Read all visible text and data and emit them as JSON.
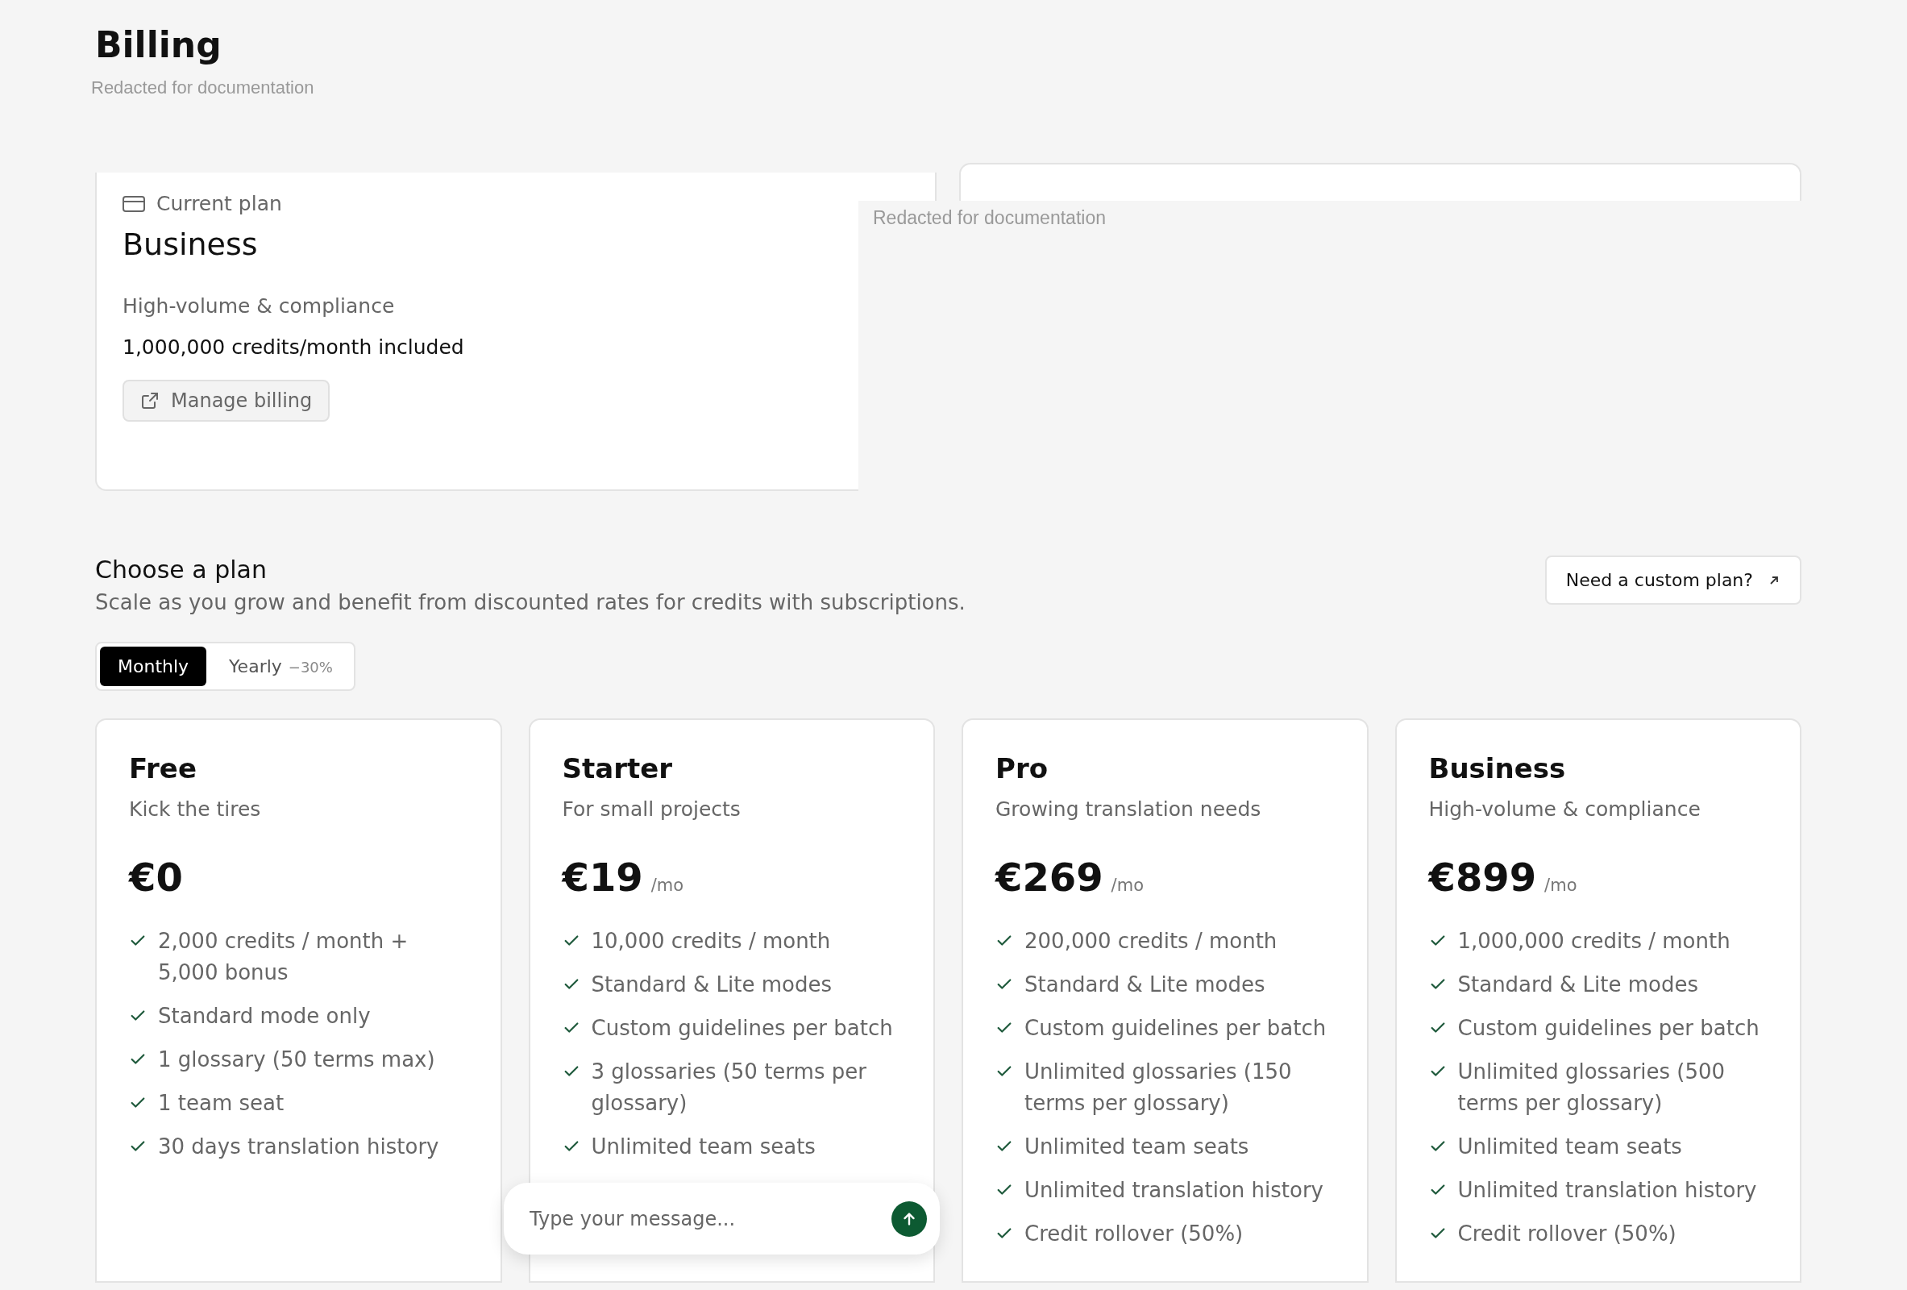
{
  "header": {
    "title": "Billing",
    "subtitle": "Redacted for documentation"
  },
  "current_plan": {
    "label": "Current plan",
    "name": "Business",
    "description": "High-volume & compliance",
    "credits": "1,000,000 credits/month included",
    "button": "Manage billing"
  },
  "redaction": {
    "text": "Redacted for documentation"
  },
  "plans_section": {
    "title": "Choose a plan",
    "subtitle": "Scale as you grow and benefit from discounted rates for credits with subscriptions.",
    "custom_plan_button": "Need a custom plan?",
    "billing_toggle": [
      {
        "label": "Monthly",
        "selected": true
      },
      {
        "label": "Yearly",
        "badge": "−30%",
        "selected": false
      }
    ],
    "plans": [
      {
        "name": "Free",
        "tagline": "Kick the tires",
        "price": "€0",
        "features": [
          "2,000 credits / month + 5,000 bonus",
          "Standard mode only",
          "1 glossary (50 terms max)",
          "1 team seat",
          "30 days translation history"
        ]
      },
      {
        "name": "Starter",
        "tagline": "For small projects",
        "price": "€19",
        "period": "/mo",
        "features": [
          "10,000 credits / month",
          "Standard & Lite modes",
          "Custom guidelines per batch",
          "3 glossaries (50 terms per glossary)",
          "Unlimited team seats"
        ]
      },
      {
        "name": "Pro",
        "tagline": "Growing translation needs",
        "price": "€269",
        "period": "/mo",
        "features": [
          "200,000 credits / month",
          "Standard & Lite modes",
          "Custom guidelines per batch",
          "Unlimited glossaries (150 terms per glossary)",
          "Unlimited team seats",
          "Unlimited translation history",
          "Credit rollover (50%)"
        ]
      },
      {
        "name": "Business",
        "tagline": "High-volume & compliance",
        "price": "€899",
        "period": "/mo",
        "features": [
          "1,000,000 credits / month",
          "Standard & Lite modes",
          "Custom guidelines per batch",
          "Unlimited glossaries (500 terms per glossary)",
          "Unlimited team seats",
          "Unlimited translation history",
          "Credit rollover (50%)"
        ]
      }
    ]
  },
  "chat": {
    "placeholder": "Type your message..."
  }
}
